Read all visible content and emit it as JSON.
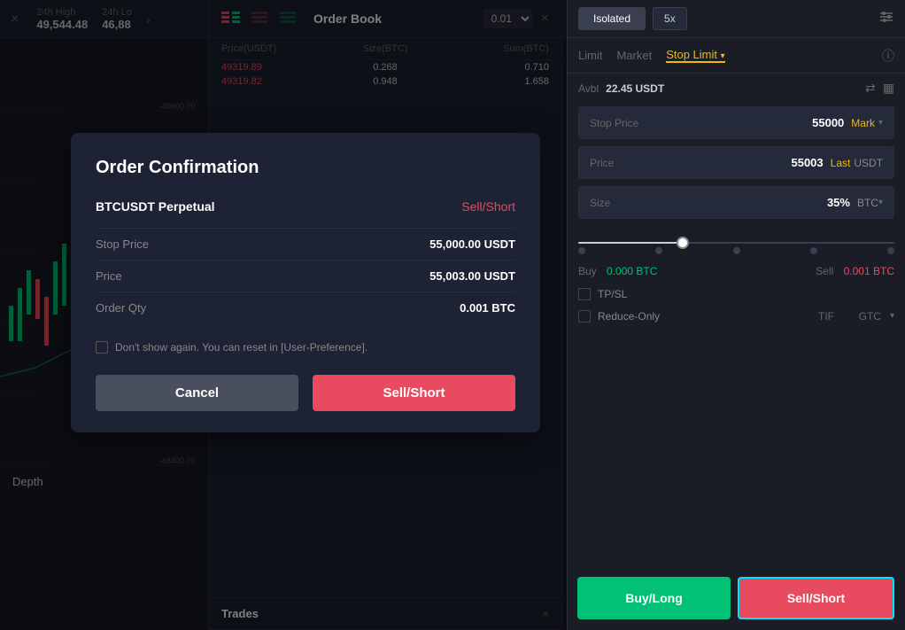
{
  "left": {
    "close_label": "×",
    "stats": {
      "high_label": "24h High",
      "high_value": "49,544.48",
      "low_label": "24h Lo",
      "low_value": "46,88"
    },
    "depth_tab": "Depth"
  },
  "orderbook": {
    "title": "Order Book",
    "close_label": "×",
    "size_value": "0.01",
    "columns": {
      "price": "Price(USDT)",
      "size": "Size(BTC)",
      "sum": "Sum(BTC)"
    },
    "asks": [
      {
        "price": "49319.89",
        "size": "0.268",
        "sum": "0.710"
      },
      {
        "price": "49319.82",
        "size": "0.948",
        "sum": "1.658"
      }
    ],
    "bids": []
  },
  "trades": {
    "title": "Trades",
    "close_label": "×"
  },
  "modal": {
    "title": "Order Confirmation",
    "symbol": "BTCUSDT Perpetual",
    "side": "Sell/Short",
    "stop_price_label": "Stop Price",
    "stop_price_value": "55,000.00 USDT",
    "price_label": "Price",
    "price_value": "55,003.00 USDT",
    "order_qty_label": "Order Qty",
    "order_qty_value": "0.001 BTC",
    "checkbox_label": "Don't show again. You can reset in [User-Preference].",
    "cancel_btn": "Cancel",
    "sell_btn": "Sell/Short"
  },
  "right": {
    "isolated_btn": "Isolated",
    "leverage_btn": "5x",
    "order_types": {
      "limit": "Limit",
      "market": "Market",
      "stop_limit": "Stop Limit",
      "arrow": "▾"
    },
    "avbl_label": "Avbl",
    "avbl_value": "22.45 USDT",
    "stop_price_label": "Stop Price",
    "stop_price_value": "55000",
    "stop_price_tag": "Mark",
    "price_label": "Price",
    "price_value": "55003",
    "price_tag": "Last",
    "price_unit": "USDT",
    "size_label": "Size",
    "size_pct": "35%",
    "size_unit": "BTC",
    "buy_label": "Buy",
    "buy_value": "0.000 BTC",
    "sell_label": "Sell",
    "sell_value": "0.001 BTC",
    "tpsl_label": "TP/SL",
    "reduce_label": "Reduce-Only",
    "tif_label": "TIF",
    "gtc_label": "GTC",
    "buy_btn": "Buy/Long",
    "sell_btn": "Sell/Short"
  },
  "colors": {
    "green": "#02c076",
    "red": "#e84a5f",
    "gold": "#f0b90b",
    "bg_dark": "#1a1d26",
    "bg_mid": "#1c2030",
    "bg_field": "#252a3a",
    "border": "#2a2d3a",
    "text_muted": "#666666",
    "text_main": "#c9cdd4",
    "cyan": "#00e5ff"
  }
}
